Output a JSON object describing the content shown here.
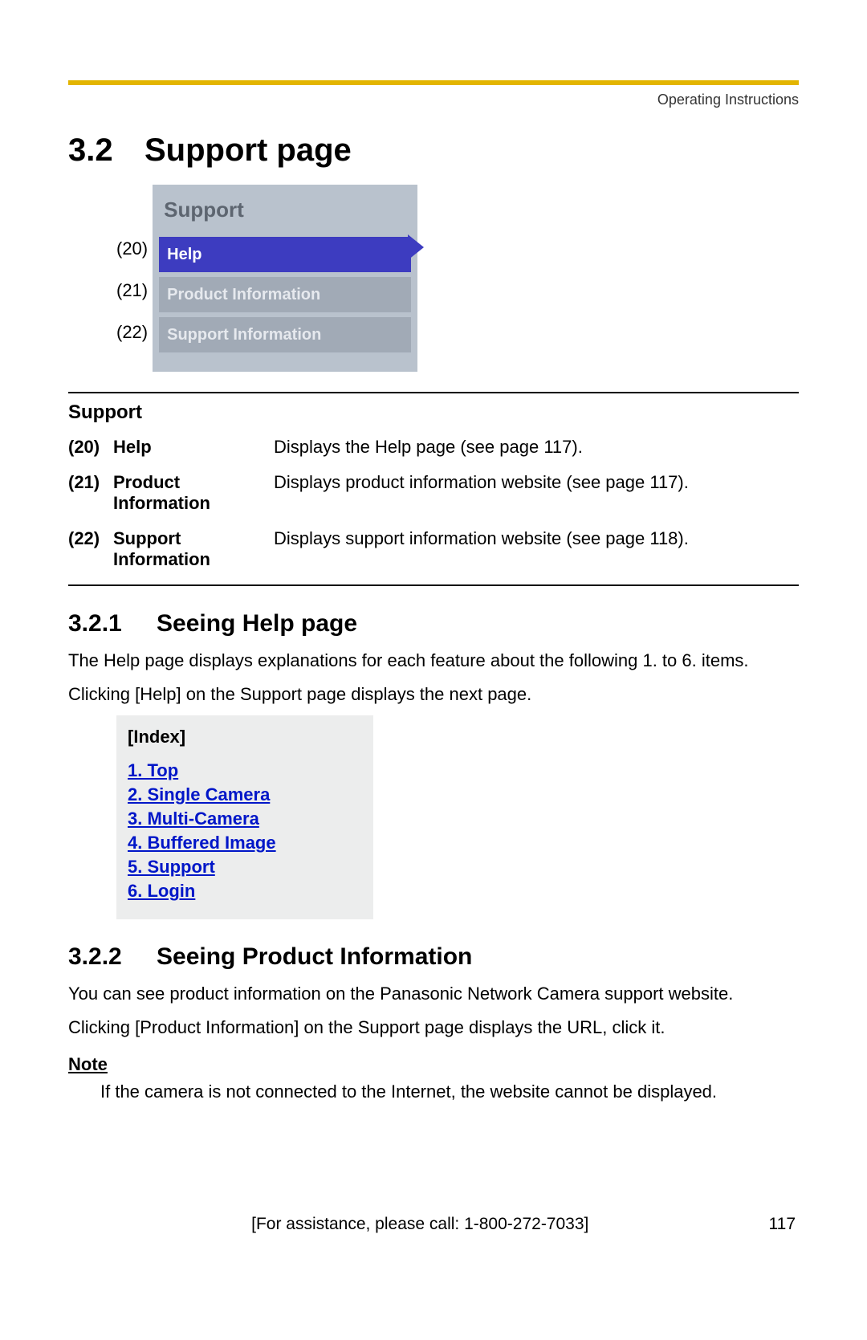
{
  "header": {
    "doc_label": "Operating Instructions"
  },
  "section": {
    "number": "3.2",
    "title": "Support page"
  },
  "menu": {
    "title": "Support",
    "items": [
      {
        "callout": "(20)",
        "label": "Help",
        "selected": true
      },
      {
        "callout": "(21)",
        "label": "Product Information",
        "selected": false
      },
      {
        "callout": "(22)",
        "label": "Support Information",
        "selected": false
      }
    ]
  },
  "defs": {
    "heading": "Support",
    "rows": [
      {
        "n": "(20)",
        "term": "Help",
        "desc": "Displays the Help page (see page 117)."
      },
      {
        "n": "(21)",
        "term": "Product Information",
        "desc": "Displays product information website (see page 117)."
      },
      {
        "n": "(22)",
        "term": "Support Information",
        "desc": "Displays support information website (see page 118)."
      }
    ]
  },
  "sub1": {
    "number": "3.2.1",
    "title": "Seeing Help page",
    "p1": "The Help page displays explanations for each feature about the following 1. to 6. items.",
    "p2": "Clicking [Help] on the Support page displays the next page."
  },
  "index": {
    "title": "[Index]",
    "links": [
      "1. Top",
      "2. Single Camera",
      "3. Multi-Camera",
      "4. Buffered Image",
      "5. Support",
      "6. Login"
    ]
  },
  "sub2": {
    "number": "3.2.2",
    "title": "Seeing Product Information",
    "p1": "You can see product information on the Panasonic Network Camera support website.",
    "p2": "Clicking [Product Information] on the Support page displays the URL, click it."
  },
  "note": {
    "label": "Note",
    "body": "If the camera is not connected to the Internet, the website cannot be displayed."
  },
  "footer": {
    "assist": "[For assistance, please call: 1-800-272-7033]",
    "page": "117"
  }
}
